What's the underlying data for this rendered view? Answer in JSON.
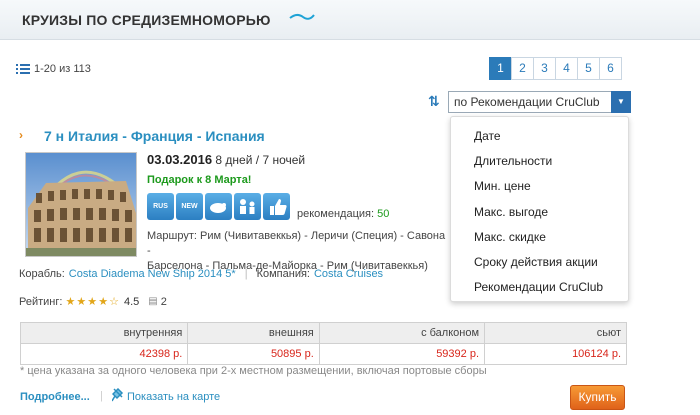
{
  "header": {
    "title": "КРУИЗЫ ПО СРЕДИЗЕМНОМОРЬЮ"
  },
  "results": {
    "count_text": "1-20 из 113"
  },
  "pagination": {
    "pages": [
      "1",
      "2",
      "3",
      "4",
      "5",
      "6"
    ],
    "active": "1"
  },
  "sort": {
    "selected": "по Рекомендации CruClub",
    "options": [
      "Дате",
      "Длительности",
      "Мин. цене",
      "Макс. выгоде",
      "Макс. скидке",
      "Сроку действия акции",
      "Рекомендации CruClub"
    ]
  },
  "cruise": {
    "title": "7 н Италия - Франция - Испания",
    "date": "03.03.2016",
    "duration": "8 дней / 7 ночей",
    "gift": "Подарок к 8 Марта!",
    "badges": [
      "RUS",
      "NEW",
      "",
      "",
      ""
    ],
    "recommend_label": "рекомендация:",
    "recommend_value": "50",
    "route_label": "Маршрут:",
    "route_line1": "Рим (Чивитавеккья) - Леричи (Специя) - Савона -",
    "route_line2": "Барселона - Пальма-де-Майорка - Рим (Чивитавеккья)",
    "ship_label": "Корабль:",
    "ship_name": "Costa Diadema New Ship 2014 5*",
    "company_label": "Компания:",
    "company_name": "Costa Cruises",
    "rating_label": "Рейтинг:",
    "rating": 4.5,
    "rating_text": "4.5",
    "comments": "2"
  },
  "prices": {
    "headers": [
      "внутренняя",
      "внешняя",
      "с балконом",
      "сьют"
    ],
    "values": [
      "42398 р.",
      "50895 р.",
      "59392 р.",
      "106124 р."
    ]
  },
  "footnote": "* цена указана за одного человека при 2-х местном размещении, включая портовые сборы",
  "actions": {
    "more": "Подробнее...",
    "map": "Показать на карте",
    "buy": "Купить"
  },
  "colors": {
    "accent": "#2b8fc0",
    "price": "#d8261b",
    "gift": "#1d9a1d",
    "buy": "#e0621a"
  }
}
